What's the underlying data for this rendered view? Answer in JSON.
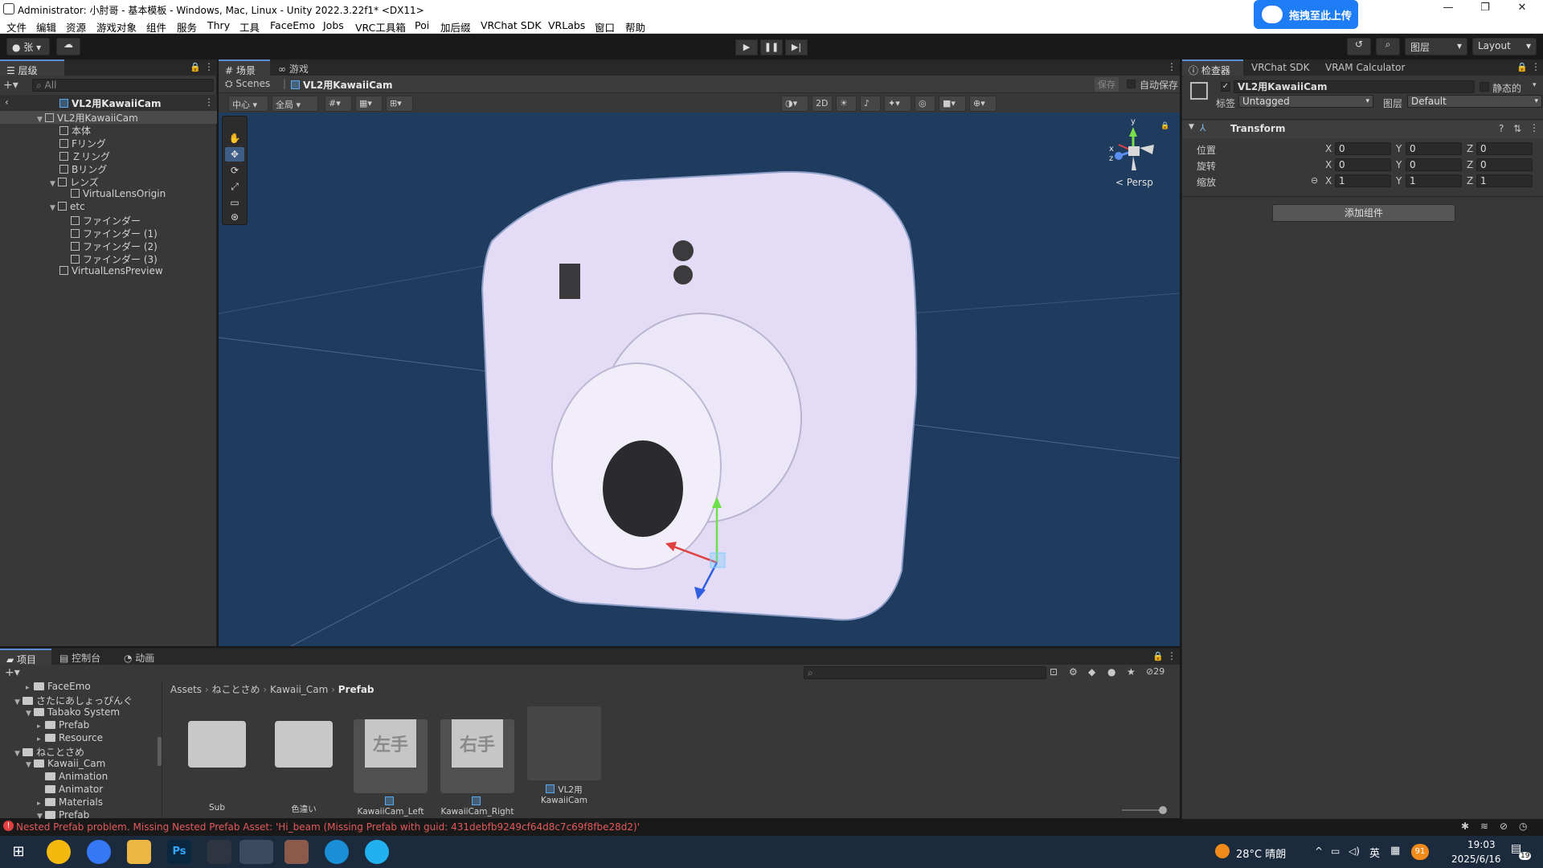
{
  "titlebar": {
    "title": "Administrator: 小肘哥 - 基本模板 - Windows, Mac, Linux - Unity 2022.3.22f1* <DX11>",
    "upload_button": "拖拽至此上传",
    "minimize": "—",
    "restore": "❐",
    "close": "✕"
  },
  "menu": [
    "文件",
    "编辑",
    "资源",
    "游戏对象",
    "组件",
    "服务",
    "Thry",
    "工具",
    "FaceEmo",
    "Jobs",
    "VRC工具箱",
    "Poi",
    "加后缀",
    "VRChat SDK",
    "VRLabs",
    "窗口",
    "帮助"
  ],
  "toolbar": {
    "account": "张",
    "layers": "图层",
    "layout": "Layout"
  },
  "hierarchy": {
    "tab": "层级",
    "search_placeholder": "All",
    "root": "VL2用KawaiiCam",
    "items": [
      {
        "label": "VL2用KawaiiCam",
        "depth": 0
      },
      {
        "label": "本体",
        "depth": 1
      },
      {
        "label": "Fリング",
        "depth": 1
      },
      {
        "label": "Ｚリング",
        "depth": 1
      },
      {
        "label": "Bリング",
        "depth": 1
      },
      {
        "label": "レンズ",
        "depth": 1
      },
      {
        "label": "VirtualLensOrigin",
        "depth": 2
      },
      {
        "label": "etc",
        "depth": 1
      },
      {
        "label": "ファインダー",
        "depth": 2
      },
      {
        "label": "ファインダー (1)",
        "depth": 2
      },
      {
        "label": "ファインダー (2)",
        "depth": 2
      },
      {
        "label": "ファインダー (3)",
        "depth": 2
      },
      {
        "label": "VirtualLensPreview",
        "depth": 1
      }
    ]
  },
  "scene": {
    "tabs": [
      "场景",
      "游戏"
    ],
    "breadcrumb_root": "Scenes",
    "breadcrumb_item": "VL2用KawaiiCam",
    "save": "保存",
    "autosave": "自动保存",
    "pivot": "中心",
    "global": "全局",
    "mode_2d": "2D",
    "persp": "< Persp",
    "gizmo_y": "y",
    "gizmo_x": "x",
    "gizmo_z": "z"
  },
  "inspector": {
    "tabs": [
      "检查器",
      "VRChat SDK",
      "VRAM Calculator"
    ],
    "object_name": "VL2用KawaiiCam",
    "static": "静态的",
    "tag_label": "标签",
    "tag_value": "Untagged",
    "layer_label": "图层",
    "layer_value": "Default",
    "component": "Transform",
    "rows": [
      {
        "label": "位置",
        "x": "0",
        "y": "0",
        "z": "0"
      },
      {
        "label": "旋转",
        "x": "0",
        "y": "0",
        "z": "0"
      },
      {
        "label": "缩放",
        "x": "1",
        "y": "1",
        "z": "1"
      }
    ],
    "axis_x": "X",
    "axis_y": "Y",
    "axis_z": "Z",
    "add_component": "添加组件"
  },
  "project": {
    "tabs": [
      "项目",
      "控制台",
      "动画"
    ],
    "hidden_count": "29",
    "tree": [
      {
        "label": "FaceEmo",
        "depth": 1
      },
      {
        "label": "さたにあしょっぴんぐ",
        "depth": 0
      },
      {
        "label": "Tabako System",
        "depth": 1
      },
      {
        "label": "Prefab",
        "depth": 2
      },
      {
        "label": "Resource",
        "depth": 2
      },
      {
        "label": "ねことさめ",
        "depth": 0
      },
      {
        "label": "Kawaii_Cam",
        "depth": 1
      },
      {
        "label": "Animation",
        "depth": 2
      },
      {
        "label": "Animator",
        "depth": 2
      },
      {
        "label": "Materials",
        "depth": 2
      },
      {
        "label": "Prefab",
        "depth": 2
      }
    ],
    "path": [
      "Assets",
      "ねことさめ",
      "Kawaii_Cam",
      "Prefab"
    ],
    "assets": [
      {
        "name": "Sub",
        "kind": "folder"
      },
      {
        "name": "色違い",
        "kind": "folder"
      },
      {
        "name": "KawaiiCam_Left",
        "kind": "prefab",
        "thumb_text": "左手"
      },
      {
        "name": "KawaiiCam_Right",
        "kind": "prefab",
        "thumb_text": "右手"
      },
      {
        "name": "VL2用KawaiiCam",
        "kind": "prefab",
        "thumb_text": ""
      }
    ]
  },
  "status": {
    "message": "Nested Prefab problem. Missing Nested Prefab Asset: 'Hi_beam (Missing Prefab with guid: 431debfb9249cf64d8c7c69f8fbe28d2)'"
  },
  "taskbar": {
    "weather": "28°C 晴朗",
    "ime": "英",
    "time": "19:03",
    "date": "2025/6/16",
    "badge": "91",
    "notif": "19"
  }
}
